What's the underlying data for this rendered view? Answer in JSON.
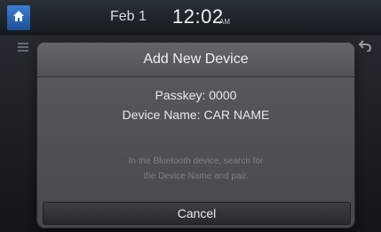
{
  "status_bar": {
    "home_icon": "home-icon",
    "date": "Feb  1",
    "time": "12:02",
    "ampm": "AM"
  },
  "background": {
    "menu_icon": "grid-menu-icon",
    "back_icon": "back-arrow-icon"
  },
  "dialog": {
    "title": "Add New Device",
    "passkey_label": "Passkey:",
    "passkey_value": "0000",
    "device_name_label": "Device Name:",
    "device_name_value": "CAR NAME",
    "hint_line1": "In the Bluetooth device, search for",
    "hint_line2": "the Device Name and pair.",
    "cancel_label": "Cancel"
  }
}
